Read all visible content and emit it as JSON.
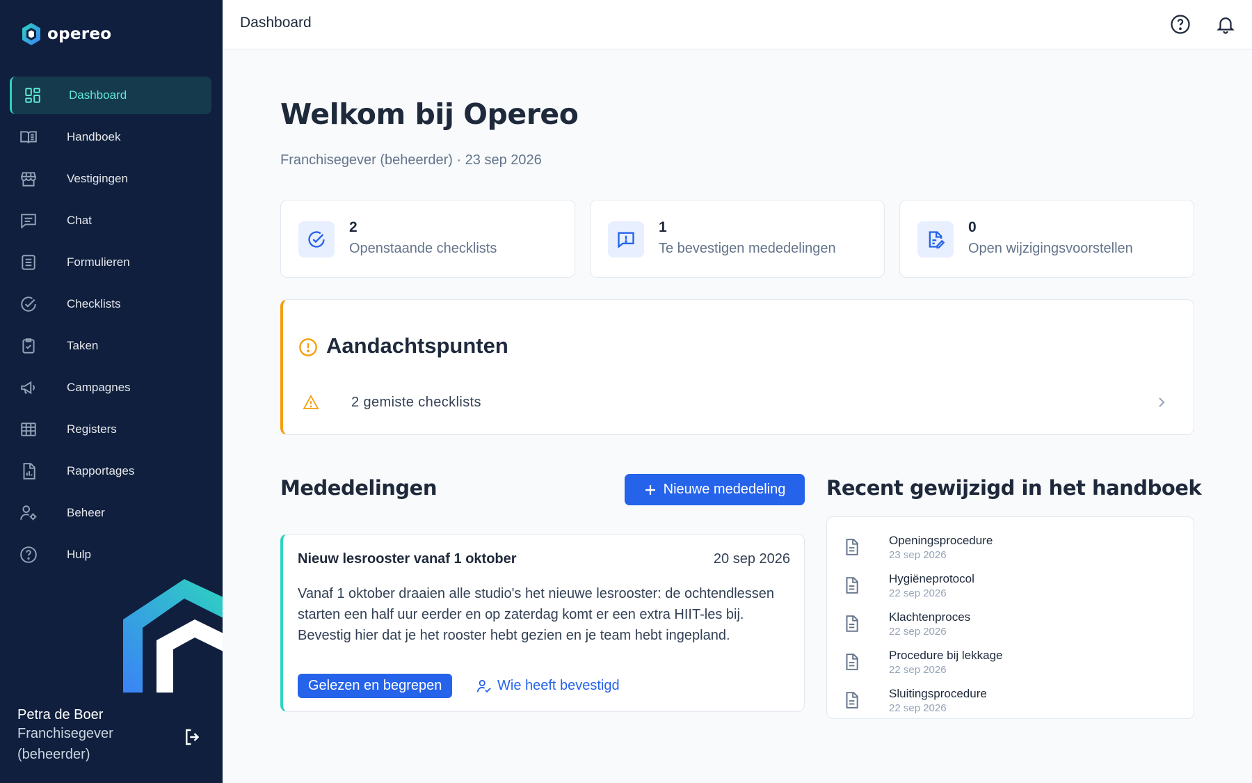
{
  "app": {
    "name": "opereo"
  },
  "header": {
    "title": "Dashboard"
  },
  "sidebar": {
    "items": [
      {
        "label": "Dashboard",
        "icon": "dashboard-icon",
        "active": true
      },
      {
        "label": "Handboek",
        "icon": "book-icon"
      },
      {
        "label": "Vestigingen",
        "icon": "store-icon"
      },
      {
        "label": "Chat",
        "icon": "chat-icon"
      },
      {
        "label": "Formulieren",
        "icon": "form-icon"
      },
      {
        "label": "Checklists",
        "icon": "check-circle-icon"
      },
      {
        "label": "Taken",
        "icon": "clipboard-check-icon"
      },
      {
        "label": "Campagnes",
        "icon": "megaphone-icon"
      },
      {
        "label": "Registers",
        "icon": "table-icon"
      },
      {
        "label": "Rapportages",
        "icon": "report-icon"
      },
      {
        "label": "Beheer",
        "icon": "user-gear-icon"
      },
      {
        "label": "Hulp",
        "icon": "help-icon"
      }
    ],
    "user": {
      "name": "Petra de Boer",
      "role": "Franchisegever (beheerder)"
    }
  },
  "main": {
    "welcome": "Welkom bij Opereo",
    "subtitle": "Franchisegever (beheerder) · 23 sep 2026",
    "stats": [
      {
        "value": "2",
        "label": "Openstaande checklists",
        "icon": "check-circle-icon"
      },
      {
        "value": "1",
        "label": "Te bevestigen mededelingen",
        "icon": "message-alert-icon"
      },
      {
        "value": "0",
        "label": "Open wijzigingsvoorstellen",
        "icon": "document-edit-icon"
      }
    ],
    "attention": {
      "title": "Aandachtspunten",
      "items": [
        {
          "text": "2 gemiste checklists"
        }
      ]
    },
    "announcements": {
      "title": "Mededelingen",
      "new_button": "Nieuwe mededeling",
      "items": [
        {
          "title": "Nieuw lesrooster vanaf 1 oktober",
          "date": "20 sep 2026",
          "body": "Vanaf 1 oktober draaien alle studio's het nieuwe lesrooster: de ochtendlessen starten een half uur eerder en op zaterdag komt er een extra HIIT-les bij. Bevestig hier dat je het rooster hebt gezien en je team hebt ingepland.",
          "confirm_label": "Gelezen en begrepen",
          "who_label": "Wie heeft bevestigd"
        }
      ]
    },
    "recent": {
      "title": "Recent gewijzigd in het handboek",
      "items": [
        {
          "title": "Openingsprocedure",
          "date": "23 sep 2026"
        },
        {
          "title": "Hygiëneprotocol",
          "date": "22 sep 2026"
        },
        {
          "title": "Klachtenproces",
          "date": "22 sep 2026"
        },
        {
          "title": "Procedure bij lekkage",
          "date": "22 sep 2026"
        },
        {
          "title": "Sluitingsprocedure",
          "date": "22 sep 2026"
        }
      ]
    }
  },
  "colors": {
    "sidebar_bg": "#0f1f3d",
    "accent_teal": "#2dd4bf",
    "primary_blue": "#2563eb",
    "warning": "#f59e0b"
  }
}
